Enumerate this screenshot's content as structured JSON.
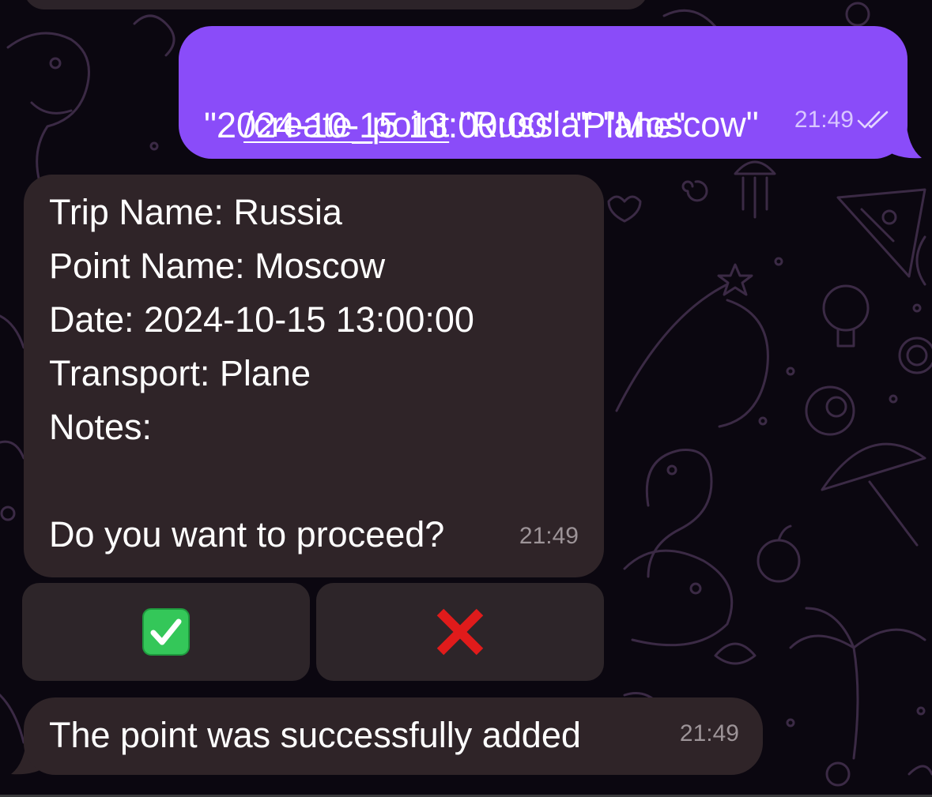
{
  "chat": {
    "colors": {
      "background": "#0b0710",
      "outgoing_bubble": "#8a4cf9",
      "incoming_bubble": "#2f2428",
      "button": "#2d2529",
      "check_green": "#34c759",
      "cross_red": "#e01b1b"
    },
    "outgoing_message": {
      "command": "/create_point",
      "args_line1": " \"Russia\" \"Moscow\"",
      "args_line2": "\"2024-10-15 13:00:00\" \"Plane\"",
      "time": "21:49",
      "status_icon": "double-check-icon"
    },
    "confirmation_message": {
      "lines": [
        "Trip Name: Russia",
        "Point Name: Moscow",
        "Date: 2024-10-15 13:00:00",
        "Transport: Plane",
        "Notes:",
        "",
        "Do you want to proceed?"
      ],
      "time": "21:49"
    },
    "inline_buttons": [
      {
        "icon": "green-check-emoji-icon"
      },
      {
        "icon": "red-cross-emoji-icon"
      }
    ],
    "result_message": {
      "text": "The point was successfully added",
      "time": "21:49"
    }
  }
}
